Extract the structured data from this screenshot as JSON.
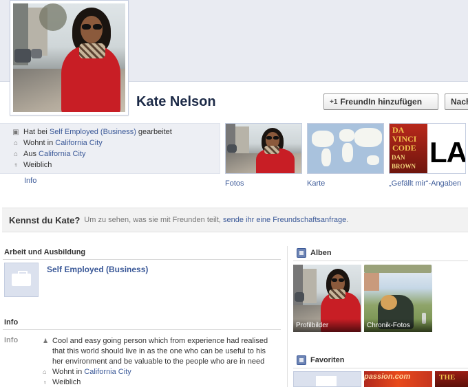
{
  "profile": {
    "name": "Kate Nelson",
    "add_friend_label": "FreundIn hinzufügen",
    "next_button_label": "Nach"
  },
  "about": {
    "lines": [
      {
        "prefix": "Hat bei ",
        "link": "Self Employed (Business)",
        "suffix": " gearbeitet",
        "icon": "briefcase-icon"
      },
      {
        "prefix": "Wohnt in ",
        "link": "California City",
        "suffix": "",
        "icon": "house-icon"
      },
      {
        "prefix": "Aus ",
        "link": "California City",
        "suffix": "",
        "icon": "pin-icon"
      },
      {
        "prefix": "Weiblich",
        "link": "",
        "suffix": "",
        "icon": "female-icon"
      }
    ],
    "info_tab": "Info"
  },
  "thumbs": {
    "photos_label": "Fotos",
    "map_label": "Karte",
    "likes_label": "„Gefällt mir“-Angaben",
    "book_title": "DA VINCI CODE",
    "book_author": "DAN BROWN",
    "la_text": "LA"
  },
  "know": {
    "title": "Kennst du Kate?",
    "text": "Um zu sehen, was sie mit Freunden teilt, ",
    "link": "sende ihr eine Freundschaftsanfrage",
    "suffix": "."
  },
  "work": {
    "heading": "Arbeit und Ausbildung",
    "employer": "Self Employed (Business)"
  },
  "info_section": {
    "heading": "Info",
    "label": "Info",
    "bio": "Cool and easy going person which from experience had realised that this world should live in as the one who can be useful to his her environment and be valuable to the people who are in need",
    "lives_prefix": "Wohnt in ",
    "lives_link": "California City",
    "gender": "Weiblich"
  },
  "albums": {
    "heading": "Alben",
    "items": [
      {
        "label": "Profilbilder"
      },
      {
        "label": "Chronik-Fotos"
      }
    ]
  },
  "favorites": {
    "heading": "Favoriten",
    "items": [
      "",
      "passion.com",
      "THE"
    ]
  },
  "colors": {
    "link": "#3b5998",
    "cover": "#e9ebf2",
    "info_bg": "#edeff4",
    "coat_red": "#c81e25"
  }
}
